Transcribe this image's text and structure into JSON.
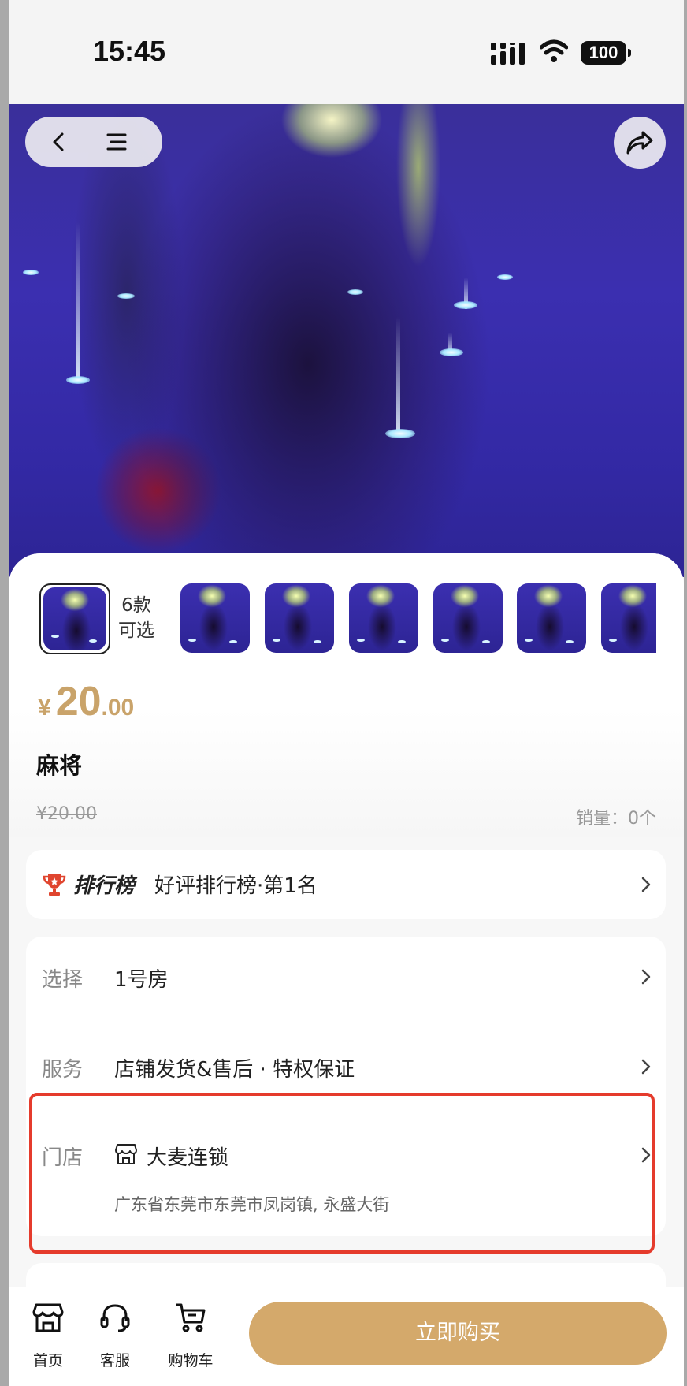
{
  "status_bar": {
    "time": "15:45",
    "battery": "100"
  },
  "hero": {
    "icons": {
      "back": "chevron-left-icon",
      "menu": "menu-icon",
      "share": "share-icon"
    }
  },
  "variants": {
    "count_line1": "6款",
    "count_line2": "可选",
    "total": 6
  },
  "product": {
    "price_currency": "¥",
    "price_integer": "20",
    "price_decimal": ".00",
    "title": "麻将",
    "original_price": "¥20.00",
    "sales": "销量：0个"
  },
  "ranking": {
    "brand": "排行榜",
    "text": "好评排行榜·第1名"
  },
  "details": {
    "select_label": "选择",
    "select_value": "1号房",
    "service_label": "服务",
    "service_value": "店铺发货&售后 · 特权保证",
    "store_label": "门店",
    "store_name": "大麦连锁",
    "store_address": "广东省东莞市东莞市凤岗镇, 永盛大街"
  },
  "bottom_bar": {
    "home": "首页",
    "service": "客服",
    "cart": "购物车",
    "buy": "立即购买"
  },
  "colors": {
    "accent": "#d4a96b",
    "price": "#c9a36a",
    "highlight": "#e53b2c"
  }
}
